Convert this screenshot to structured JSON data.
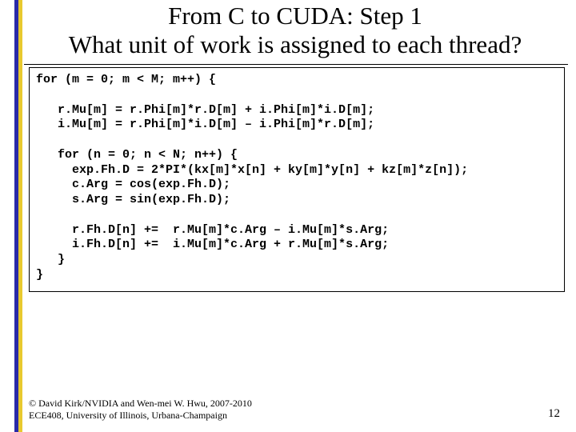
{
  "title": {
    "line1": "From C to CUDA: Step 1",
    "line2": "What unit of work is assigned to each thread?"
  },
  "code": {
    "l01": "for (m = 0; m < M; m++) {",
    "l02": "",
    "l03": "   r.Mu[m] = r.Phi[m]*r.D[m] + i.Phi[m]*i.D[m];",
    "l04": "   i.Mu[m] = r.Phi[m]*i.D[m] – i.Phi[m]*r.D[m];",
    "l05": "",
    "l06": "   for (n = 0; n < N; n++) {",
    "l07": "     exp.Fh.D = 2*PI*(kx[m]*x[n] + ky[m]*y[n] + kz[m]*z[n]);",
    "l08": "     c.Arg = cos(exp.Fh.D);",
    "l09": "     s.Arg = sin(exp.Fh.D);",
    "l10": "",
    "l11": "     r.Fh.D[n] +=  r.Mu[m]*c.Arg – i.Mu[m]*s.Arg;",
    "l12": "     i.Fh.D[n] +=  i.Mu[m]*c.Arg + r.Mu[m]*s.Arg;",
    "l13": "   }",
    "l14": "}"
  },
  "footer": {
    "credit_line1": "© David Kirk/NVIDIA and Wen-mei W. Hwu, 2007-2010",
    "credit_line2": "ECE408, University of Illinois, Urbana-Champaign",
    "page_number": "12"
  }
}
